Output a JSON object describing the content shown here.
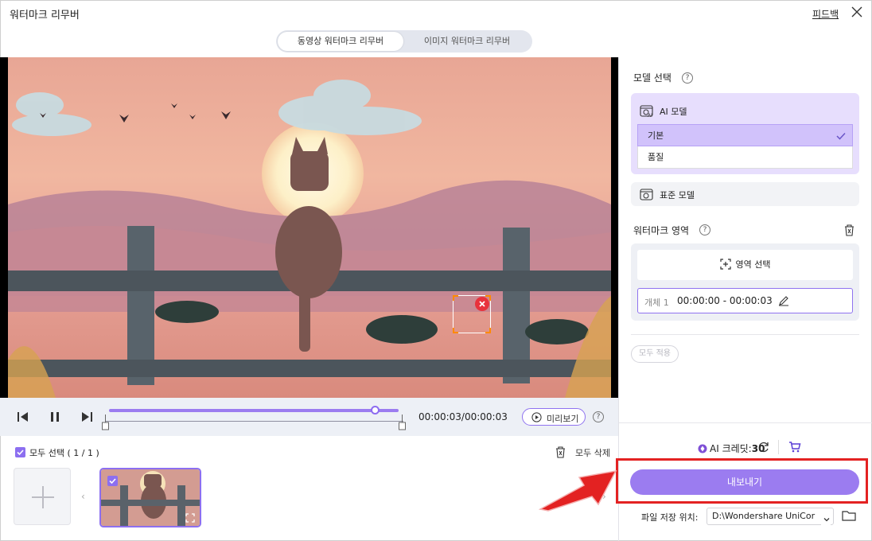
{
  "window": {
    "title": "워터마크 리무버",
    "feedback_label": "피드백"
  },
  "tabs": {
    "video_label": "동영상 워터마크 리무버",
    "image_label": "이미지 워터마크 리무버"
  },
  "player": {
    "timecode": "00:00:03/00:00:03",
    "preview_label": "미리보기",
    "progress_fraction": 0.91
  },
  "clips": {
    "select_all_label": "모두 선택 ( 1 / 1 )",
    "delete_all_label": "모두 삭제",
    "add_symbol": "+",
    "prev_arrow": "‹",
    "next_arrow": "›"
  },
  "panel": {
    "model_section_title": "모델 선택",
    "ai_model_label": "AI 모델",
    "ai_model_options": [
      "기본",
      "품질"
    ],
    "selected_option_index": 0,
    "standard_model_label": "표준 모델",
    "watermark_area_title": "워터마크 영역",
    "area_select_label": "영역 선택",
    "object_label": "개체 1",
    "object_time": "00:00:00 - 00:00:03",
    "apply_all_label": "모두 적용",
    "credits_label": "AI 크레딧:",
    "credits_value": "30",
    "export_label": "내보내기",
    "save_location_label": "파일 저장 위치:",
    "save_location_value": "D:\\Wondershare UniCor"
  },
  "colors": {
    "accent": "#9b7cf0",
    "highlight_frame": "#e32222"
  },
  "icons": [
    "close-icon",
    "step-back-icon",
    "pause-icon",
    "step-forward-icon",
    "play-circle-icon",
    "help-icon",
    "trash-icon",
    "area-select-icon",
    "edit-icon",
    "credit-icon",
    "refresh-icon",
    "cart-icon",
    "folder-icon",
    "chevron-down-icon",
    "checkmark-icon",
    "pointer-arrow-icon"
  ]
}
